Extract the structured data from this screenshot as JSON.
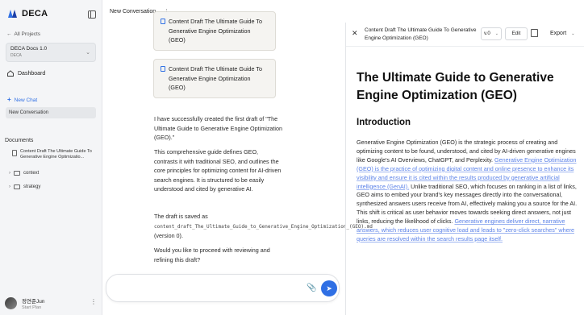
{
  "sidebar": {
    "logo_text": "DECA",
    "back_link": "All Projects",
    "project": {
      "name": "DECA Docs 1.0",
      "org": "DECA"
    },
    "dashboard_label": "Dashboard",
    "new_chat_label": "New Chat",
    "chat_items": [
      "New Conversation"
    ],
    "documents_label": "Documents",
    "doc_file": "Content Draft The Ultimate Guide To Generative Engine Optimizatio...",
    "folders": [
      "context",
      "strategy"
    ],
    "user": {
      "name": "정연준Jun",
      "plan": "Start Plan"
    }
  },
  "chat": {
    "title": "New Conversation",
    "cards": [
      "Content Draft The Ultimate Guide To Generative Engine Optimization (GEO)",
      "Content Draft The Ultimate Guide To Generative Engine Optimization (GEO)"
    ],
    "messages": {
      "p1": "I have successfully created the first draft of \"The Ultimate Guide to Generative Engine Optimization (GEO).\"",
      "p2": "This comprehensive guide defines GEO, contrasts it with traditional SEO, and outlines the core principles for optimizing content for AI-driven search engines. It is structured to be easily understood and cited by generative AI.",
      "p3_pre": "The draft is saved as",
      "p3_file": "content_draft_The_Ultimate_Guide_to_Generative_Engine_Optimization_(GEO).md",
      "p3_post": "(version 0).",
      "p4": "Would you like to proceed with reviewing and refining this draft?"
    },
    "composer_placeholder": ""
  },
  "document": {
    "header_title": "Content Draft The Ultimate Guide To Generative Engine Optimization (GEO)",
    "version": "v.0",
    "edit_label": "Edit",
    "export_label": "Export",
    "h1": "The Ultimate Guide to Generative Engine Optimization (GEO)",
    "h2": "Introduction",
    "body": {
      "s1": "Generative Engine Optimization (GEO) is the strategic process of creating and optimizing content to be found, understood, and cited by AI-driven generative engines like Google's AI Overviews, ChatGPT, and Perplexity.",
      "s2": "Generative Engine Optimization (GEO) is the practice of optimizing digital content and online presence to enhance its visibility and ensure it is cited within the results produced by generative artificial intelligence (GenAI).",
      "s3": "Unlike traditional SEO, which focuses on ranking in a list of links, GEO aims to embed your brand's key messages directly into the conversational, synthesized answers users receive from AI, effectively making you a source for the AI. This shift is critical as user behavior moves towards seeking direct answers, not just links, reducing the likelihood of clicks.",
      "s4": "Generative engines deliver direct, narrative answers, which reduces user cognitive load and leads to \"zero-click searches\" where queries are resolved within the search results page itself."
    }
  },
  "colors": {
    "accent": "#2f6fe4",
    "highlight": "#5b82e8"
  }
}
